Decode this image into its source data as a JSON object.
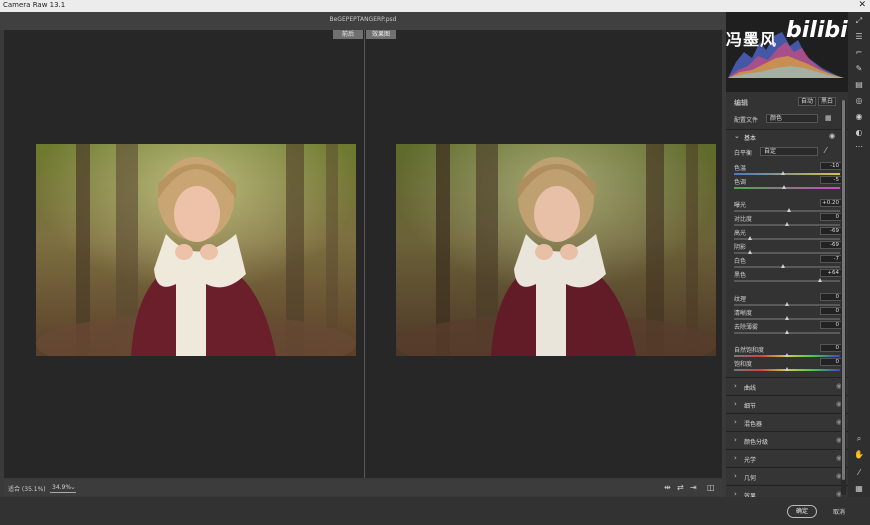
{
  "app": {
    "title": "Camera Raw 13.1",
    "close_glyph": "✕"
  },
  "document": {
    "filename": "BeGEPEPTANGERP.psd"
  },
  "view_toggle": {
    "before": "前后",
    "after": "效果图"
  },
  "watermark": {
    "text": "冯墨风",
    "brand": "bilibili"
  },
  "bottom": {
    "zoom_label": "适合 (35.1%)",
    "zoom_value": "34.9%"
  },
  "footer": {
    "ok": "确定",
    "cancel": "取消"
  },
  "panel": {
    "edit_title": "编辑",
    "auto": "自动",
    "bw": "黑白",
    "profile_label": "配置文件",
    "profile_value": "颜色",
    "basic_title": "基本",
    "wb_label": "白平衡",
    "wb_value": "自定",
    "sliders_wb": [
      {
        "label": "色温",
        "value": "-10",
        "pos": 0.47
      },
      {
        "label": "色调",
        "value": "-5",
        "pos": 0.48
      }
    ],
    "sliders_tone": [
      {
        "label": "曝光",
        "value": "+0.20",
        "pos": 0.52
      },
      {
        "label": "对比度",
        "value": "0",
        "pos": 0.5
      },
      {
        "label": "高光",
        "value": "-69",
        "pos": 0.16
      },
      {
        "label": "阴影",
        "value": "-69",
        "pos": 0.16
      },
      {
        "label": "白色",
        "value": "-7",
        "pos": 0.47
      },
      {
        "label": "黑色",
        "value": "+64",
        "pos": 0.82
      }
    ],
    "sliders_presence": [
      {
        "label": "纹理",
        "value": "0",
        "pos": 0.5
      },
      {
        "label": "清晰度",
        "value": "0",
        "pos": 0.5
      },
      {
        "label": "去除薄雾",
        "value": "0",
        "pos": 0.5
      }
    ],
    "sliders_color": [
      {
        "label": "自然饱和度",
        "value": "0",
        "pos": 0.5
      },
      {
        "label": "饱和度",
        "value": "0",
        "pos": 0.5
      }
    ],
    "sections": [
      "曲线",
      "细节",
      "混色器",
      "颜色分级",
      "光学",
      "几何",
      "效果"
    ]
  },
  "icons": {
    "tools": [
      "expand-icon",
      "sliders-icon",
      "crop-icon",
      "brush-icon",
      "gradient-icon",
      "radial-icon",
      "redeye-icon",
      "presets-icon",
      "more-icon",
      "zoom-icon",
      "hand-icon",
      "eyedropper-icon",
      "grid-icon"
    ],
    "bottom": [
      "compare-icon",
      "swap-icon",
      "copy-icon",
      "split-icon"
    ]
  },
  "colors": {
    "accent": "#5b8dd9",
    "panel_bg": "#333333",
    "canvas_bg": "#282728"
  }
}
